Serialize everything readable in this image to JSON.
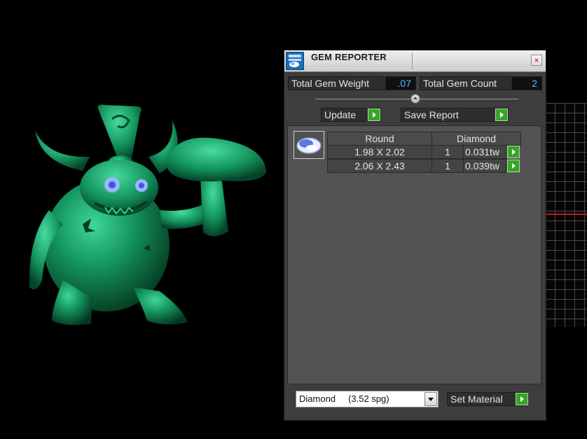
{
  "window": {
    "title": "GEM REPORTER",
    "close_label": "×"
  },
  "summary": {
    "weight_label": "Total Gem Weight",
    "weight_value": ".07",
    "count_label": "Total Gem Count",
    "count_value": "2"
  },
  "actions": {
    "update_label": "Update",
    "save_label": "Save Report"
  },
  "gem_table": {
    "shape": "Round",
    "material": "Diamond",
    "rows": [
      {
        "size": "1.98 X 2.02",
        "count": "1",
        "weight": "0.031tw"
      },
      {
        "size": "2.06 X 2.43",
        "count": "1",
        "weight": "0.039tw"
      }
    ]
  },
  "material_picker": {
    "selected": "Diamond     (3.52 spg)",
    "set_label": "Set Material"
  },
  "colors": {
    "value_text": "#3cc8ff",
    "play_button": "#3aa32b",
    "model": "#14945e",
    "grid_axis": "#c81818"
  },
  "icons": {
    "app": "gem-reporter-app-icon",
    "gem_thumbnail": "oval-gem-icon",
    "play": "play-arrow-icon",
    "dropdown": "chevron-down-icon"
  }
}
